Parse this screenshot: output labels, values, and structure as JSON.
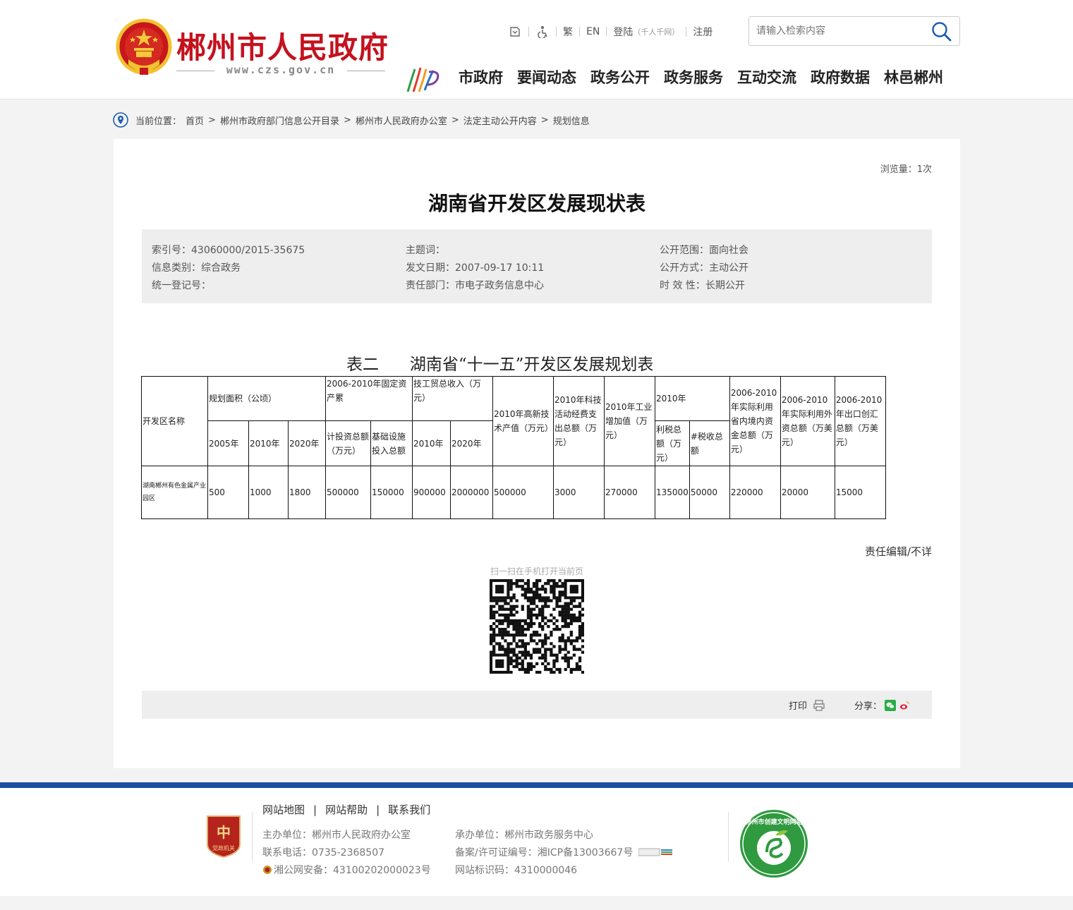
{
  "header": {
    "site_title": "郴州市人民政府",
    "site_url": "www.czs.gov.cn",
    "toplinks": {
      "lang_trad": "繁",
      "lang_en": "EN",
      "login": "登陆",
      "login_note": "（千人千网）",
      "register": "注册"
    },
    "search_placeholder": "请输入检索内容",
    "nav": [
      "市政府",
      "要闻动态",
      "政务公开",
      "政务服务",
      "互动交流",
      "政府数据",
      "林邑郴州"
    ]
  },
  "breadcrumb": {
    "label": "当前位置：",
    "items": [
      "首页",
      "郴州市政府部门信息公开目录",
      "郴州市人民政府办公室",
      "法定主动公开内容",
      "规划信息"
    ],
    "separator": ">"
  },
  "article": {
    "views": "浏览量：1次",
    "title": "湖南省开发区发展现状表",
    "meta": {
      "index_no": "索引号：43060000/2015-35675",
      "topic": "主题词：",
      "scope": "公开范围：面向社会",
      "category": "信息类别：综合政务",
      "date": "发文日期：2007-09-17 10:11",
      "method": "公开方式：主动公开",
      "reg_no": "统一登记号：",
      "dept": "责任部门：市电子政务信息中心",
      "validity": "时 效 性：长期公开"
    },
    "table_caption": "表二      湖南省“十一五”开发区发展规划表",
    "table": {
      "h_name": "开发区名称",
      "h_area": "规划面积（公顷）",
      "h_2005": "2005年",
      "h_2010": "2010年",
      "h_2020": "2020年",
      "h_invest": "2006-2010年固定资产累",
      "h_invest_total": "计投资总额（万元）",
      "h_infra": "基础设施投入总额",
      "h_trade": "技工贸总收入（万元）",
      "h_trade_2010": "2010年",
      "h_trade_2020": "2020年",
      "h_hitech": "2010年高新技术产值（万元）",
      "h_rnd": "2010年科技活动经费支出总额（万元）",
      "h_industry": "2010年工业增加值（万元）",
      "h_profit_year": "2010年",
      "h_profit": "利税总额（万元）",
      "h_tax": "#税收总额",
      "h_domestic": "2006-2010年实际利用省内境内资金总额（万元）",
      "h_foreign": "2006-2010年实际利用外资总额（万美元）",
      "h_export": "2006-2010年出口创汇总额（万美元）",
      "rows": [
        {
          "name": "湖南郴州有色金属产业园区",
          "a2005": "500",
          "a2010": "1000",
          "a2020": "1800",
          "invest": "500000",
          "infra": "150000",
          "trade2010": "900000",
          "trade2020": "2000000",
          "hitech": "500000",
          "rnd": "3000",
          "industry": "270000",
          "profit": "135000",
          "tax": "50000",
          "domestic": "220000",
          "foreign": "20000",
          "export": "15000"
        }
      ]
    },
    "editor": "责任编辑/不详",
    "qr_caption": "扫一扫在手机打开当前页",
    "print_label": "打印",
    "share_label": "分享："
  },
  "footer": {
    "links": [
      "网站地图",
      "网站帮助",
      "联系我们"
    ],
    "host": "主办单位：郴州市人民政府办公室",
    "phone": "联系电话：0735-2368507",
    "police": "湘公网安备：43100202000023号",
    "undertaker": "承办单位：郴州市政务服务中心",
    "icp": "备案/许可证编号：湘ICP备13003667号",
    "site_code": "网站标识码：4310000046",
    "party_badge_text": "党政机关",
    "civil_badge_text": "郴州市创建文明网站"
  },
  "colors": {
    "brand_red": "#c4121e",
    "footer_blue": "#1b4fa0",
    "meta_bg": "#eeeeee"
  }
}
